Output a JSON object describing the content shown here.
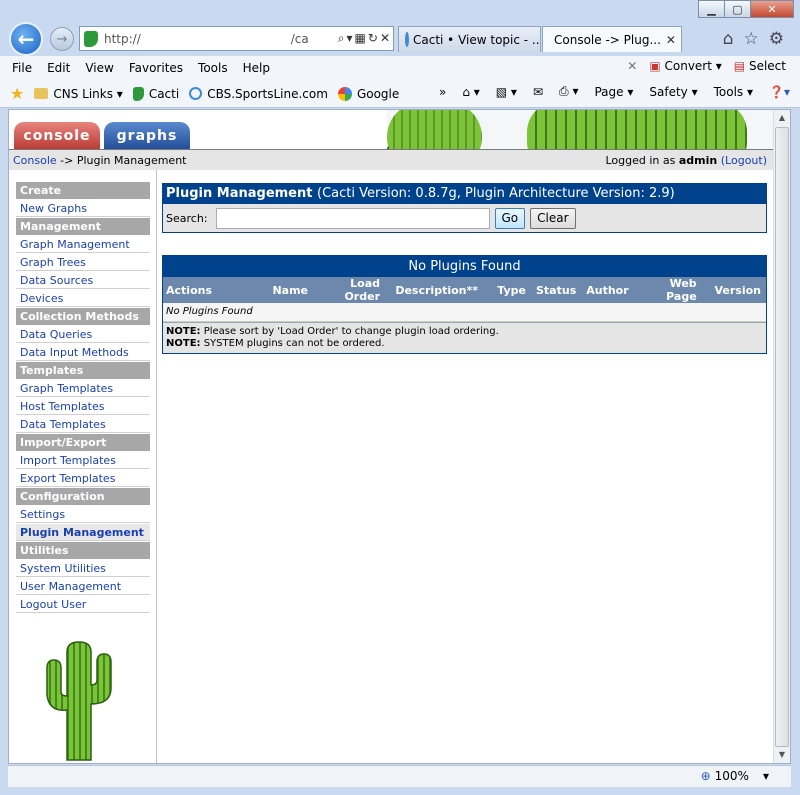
{
  "browser": {
    "address": "http://",
    "address_tail": "/cac",
    "tabs": [
      {
        "label": "Cacti • View topic - ...",
        "icon": "ie-icon"
      },
      {
        "label": "Console -> Plug...",
        "icon": "cacti-icon",
        "active": true
      }
    ],
    "menu": [
      "File",
      "Edit",
      "View",
      "Favorites",
      "Tools",
      "Help"
    ],
    "menu_right": {
      "convert": "Convert",
      "select": "Select"
    },
    "favorites": [
      {
        "label": "CNS Links",
        "icon": "folder-icon"
      },
      {
        "label": "Cacti",
        "icon": "cacti-icon"
      },
      {
        "label": "CBS.SportsLine.com",
        "icon": "ie-icon"
      },
      {
        "label": "Google",
        "icon": "google-icon"
      }
    ],
    "command_bar": {
      "page": "Page",
      "safety": "Safety",
      "tools": "Tools"
    },
    "zoom": "100%"
  },
  "cacti": {
    "tabs": {
      "console": "console",
      "graphs": "graphs"
    },
    "breadcrumb": {
      "home": "Console",
      "sep": " -> ",
      "current": "Plugin Management"
    },
    "login": {
      "prefix": "Logged in as ",
      "user": "admin",
      "logout": "(Logout)"
    },
    "sidebar": [
      {
        "type": "head",
        "label": "Create"
      },
      {
        "type": "item",
        "label": "New Graphs"
      },
      {
        "type": "head",
        "label": "Management"
      },
      {
        "type": "item",
        "label": "Graph Management"
      },
      {
        "type": "item",
        "label": "Graph Trees"
      },
      {
        "type": "item",
        "label": "Data Sources"
      },
      {
        "type": "item",
        "label": "Devices"
      },
      {
        "type": "head",
        "label": "Collection Methods"
      },
      {
        "type": "item",
        "label": "Data Queries"
      },
      {
        "type": "item",
        "label": "Data Input Methods"
      },
      {
        "type": "head",
        "label": "Templates"
      },
      {
        "type": "item",
        "label": "Graph Templates"
      },
      {
        "type": "item",
        "label": "Host Templates"
      },
      {
        "type": "item",
        "label": "Data Templates"
      },
      {
        "type": "head",
        "label": "Import/Export"
      },
      {
        "type": "item",
        "label": "Import Templates"
      },
      {
        "type": "item",
        "label": "Export Templates"
      },
      {
        "type": "head",
        "label": "Configuration"
      },
      {
        "type": "item",
        "label": "Settings"
      },
      {
        "type": "item",
        "label": "Plugin Management",
        "selected": true
      },
      {
        "type": "head",
        "label": "Utilities"
      },
      {
        "type": "item",
        "label": "System Utilities"
      },
      {
        "type": "item",
        "label": "User Management"
      },
      {
        "type": "item",
        "label": "Logout User"
      }
    ],
    "panel": {
      "title": "Plugin Management",
      "subtitle": "(Cacti Version: 0.8.7g, Plugin Architecture Version: 2.9)",
      "search_label": "Search:",
      "search_value": "",
      "go": "Go",
      "clear": "Clear"
    },
    "plugins_table": {
      "title": "No Plugins Found",
      "columns": [
        "Actions",
        "Name",
        "Load Order",
        "Description**",
        "Type",
        "Status",
        "Author",
        "Web Page",
        "Version"
      ],
      "empty_text": "No Plugins Found",
      "notes": [
        {
          "label": "NOTE:",
          "text": " Please sort by 'Load Order' to change plugin load ordering."
        },
        {
          "label": "NOTE:",
          "text": " SYSTEM plugins can not be ordered."
        }
      ]
    }
  }
}
